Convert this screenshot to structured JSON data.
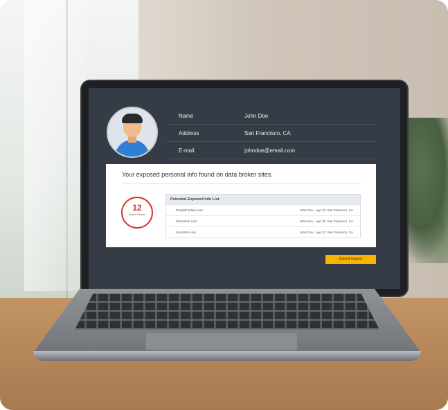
{
  "profile": {
    "fields": [
      {
        "label": "Name",
        "value": "John Doe"
      },
      {
        "label": "Address",
        "value": "San Francisco, CA"
      },
      {
        "label": "E-mail",
        "value": "johndoe@email.com"
      }
    ]
  },
  "results_card": {
    "title": "Your exposed personal info found on data broker sites.",
    "count": "12",
    "count_caption": "Search Results",
    "list_header": "Potential Exposed Info List",
    "rows": [
      {
        "site": "PeopleFinders.com",
        "detail": "John Doe - Age 37, San Francisco, CA"
      },
      {
        "site": "USSearch.com",
        "detail": "John Doe - Age 37, San Francisco, CA"
      },
      {
        "site": "ZoomInfo.com",
        "detail": "John Doe - Age 37, San Francisco, CA"
      }
    ]
  },
  "actions": {
    "submit_label": "Submit request"
  },
  "colors": {
    "screen_bg": "#363c45",
    "badge_red": "#d9342b",
    "button_yellow": "#f4b400",
    "avatar_shirt": "#2f7fd6"
  },
  "icons": [
    "user-avatar-icon"
  ]
}
